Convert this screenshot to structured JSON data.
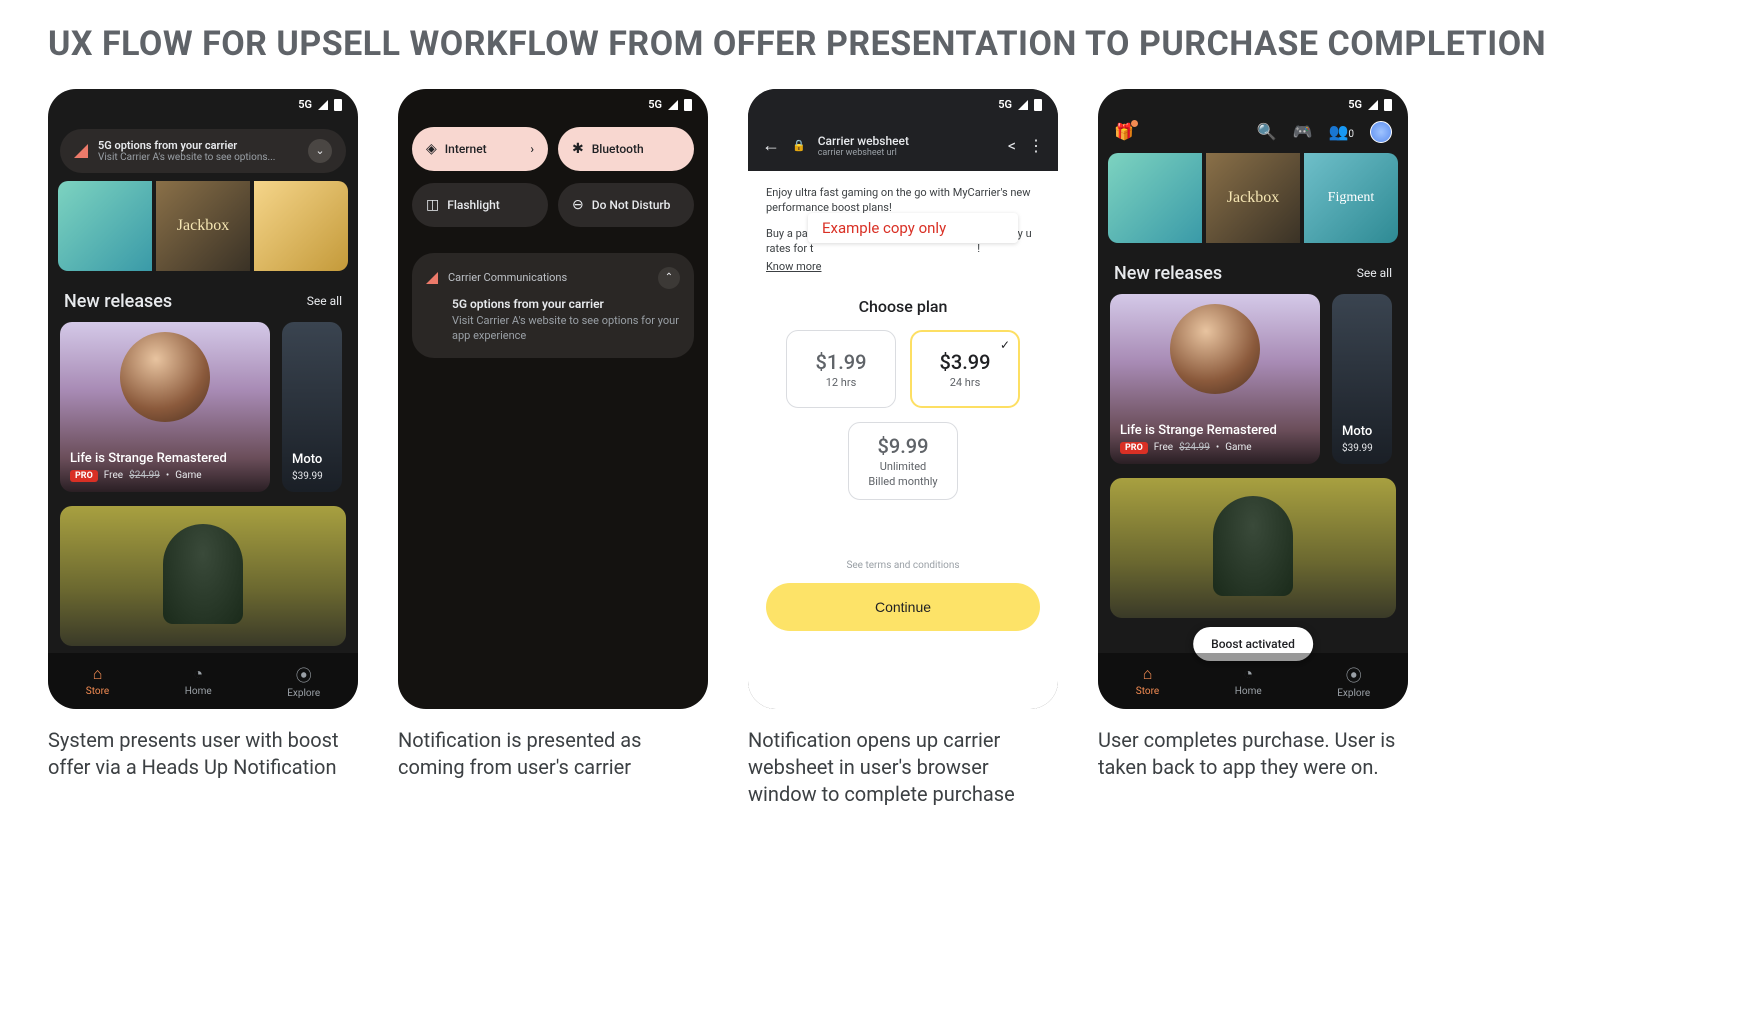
{
  "page_title": "UX FLOW FOR UPSELL WORKFLOW FROM OFFER PRESENTATION TO PURCHASE COMPLETION",
  "status": {
    "net": "5G"
  },
  "captions": {
    "c1": "System presents user with boost offer via a Heads Up Notification",
    "c2": "Notification is presented as coming from user's carrier",
    "c3": "Notification opens up carrier websheet in user's browser window to complete purchase",
    "c4": "User completes purchase. User is taken back to app they were on."
  },
  "store": {
    "promo": {
      "seg2": "Jackbox",
      "seg4": "Figment"
    },
    "section_title": "New releases",
    "see_all": "See all",
    "card1": {
      "title": "Life is Strange Remastered",
      "pro": "PRO",
      "free": "Free",
      "strike": "$24.99",
      "type": "Game"
    },
    "card2": {
      "title": "Moto",
      "price": "$39.99"
    },
    "nav": {
      "store": "Store",
      "home": "Home",
      "explore": "Explore"
    },
    "friends_count": "0",
    "toast": "Boost activated"
  },
  "hun": {
    "title": "5G options from your carrier",
    "sub": "Visit Carrier A's website to see options..."
  },
  "qs": {
    "internet": "Internet",
    "bluetooth": "Bluetooth",
    "flashlight": "Flashlight",
    "dnd": "Do Not Disturb"
  },
  "shade_notif": {
    "app": "Carrier Communications",
    "title": "5G options from your carrier",
    "text": "Visit Carrier A's website to see options for your app experience"
  },
  "websheet": {
    "header_title": "Carrier websheet",
    "header_url": "carrier websheet url",
    "copy1": "Enjoy ultra fast gaming on the go with MyCarrier's new performance boost plans!",
    "copy2a": "Buy a pas",
    "copy2b": "plan to enjoy u",
    "copy2c": "rates for t",
    "copy2d": "!",
    "know_more": "Know more",
    "example_overlay": "Example copy only",
    "choose_plan": "Choose plan",
    "plans": [
      {
        "price": "$1.99",
        "sub": "12 hrs",
        "selected": false
      },
      {
        "price": "$3.99",
        "sub": "24 hrs",
        "selected": true
      },
      {
        "price": "$9.99",
        "sub": "Unlimited",
        "sub2": "Billed monthly",
        "selected": false
      }
    ],
    "terms": "See terms and conditions",
    "continue": "Continue"
  }
}
